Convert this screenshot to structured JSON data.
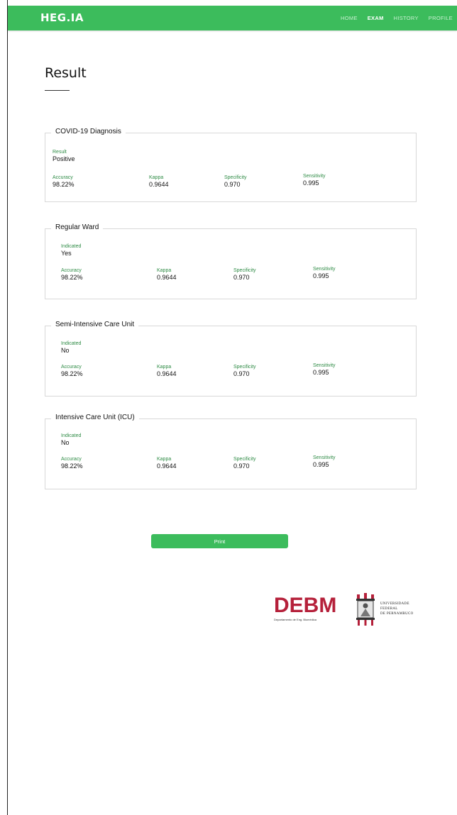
{
  "app": {
    "logo": "HEG.IA",
    "nav": [
      {
        "label": "HOME",
        "active": false
      },
      {
        "label": "EXAM",
        "active": true
      },
      {
        "label": "HISTORY",
        "active": false
      },
      {
        "label": "PROFILE",
        "active": false
      }
    ]
  },
  "page": {
    "title": "Result"
  },
  "cards": [
    {
      "title": "COVID-19 Diagnosis",
      "primary_label": "Result",
      "primary_value": "Positive",
      "metrics": [
        {
          "label": "Accuracy",
          "value": "98.22%"
        },
        {
          "label": "Kappa",
          "value": "0.9644"
        },
        {
          "label": "Specificity",
          "value": "0.970"
        },
        {
          "label": "Sensitivity",
          "value": "0.995"
        }
      ]
    },
    {
      "title": "Regular Ward",
      "primary_label": "Indicated",
      "primary_value": "Yes",
      "metrics": [
        {
          "label": "Accuracy",
          "value": "98.22%"
        },
        {
          "label": "Kappa",
          "value": "0.9644"
        },
        {
          "label": "Specificity",
          "value": "0.970"
        },
        {
          "label": "Sensitivity",
          "value": "0.995"
        }
      ]
    },
    {
      "title": "Semi-Intensive Care Unit",
      "primary_label": "Indicated",
      "primary_value": "No",
      "metrics": [
        {
          "label": "Accuracy",
          "value": "98.22%"
        },
        {
          "label": "Kappa",
          "value": "0.9644"
        },
        {
          "label": "Specificity",
          "value": "0.970"
        },
        {
          "label": "Sensitivity",
          "value": "0.995"
        }
      ]
    },
    {
      "title": "Intensive Care Unit (ICU)",
      "primary_label": "Indicated",
      "primary_value": "No",
      "metrics": [
        {
          "label": "Accuracy",
          "value": "98.22%"
        },
        {
          "label": "Kappa",
          "value": "0.9644"
        },
        {
          "label": "Specificity",
          "value": "0.970"
        },
        {
          "label": "Sensitivity",
          "value": "0.995"
        }
      ]
    }
  ],
  "actions": {
    "print_label": "Print"
  },
  "footer": {
    "debm_logo": "DEBM",
    "debm_subtitle": "Departamento de Eng. Biomédica",
    "ufpe_lines": [
      "UNIVERSIDADE",
      "FEDERAL",
      "DE PERNAMBUCO"
    ]
  },
  "colors": {
    "brand_green": "#3cbc5c",
    "label_green": "#2e8b45",
    "debm_red": "#b5203a"
  }
}
